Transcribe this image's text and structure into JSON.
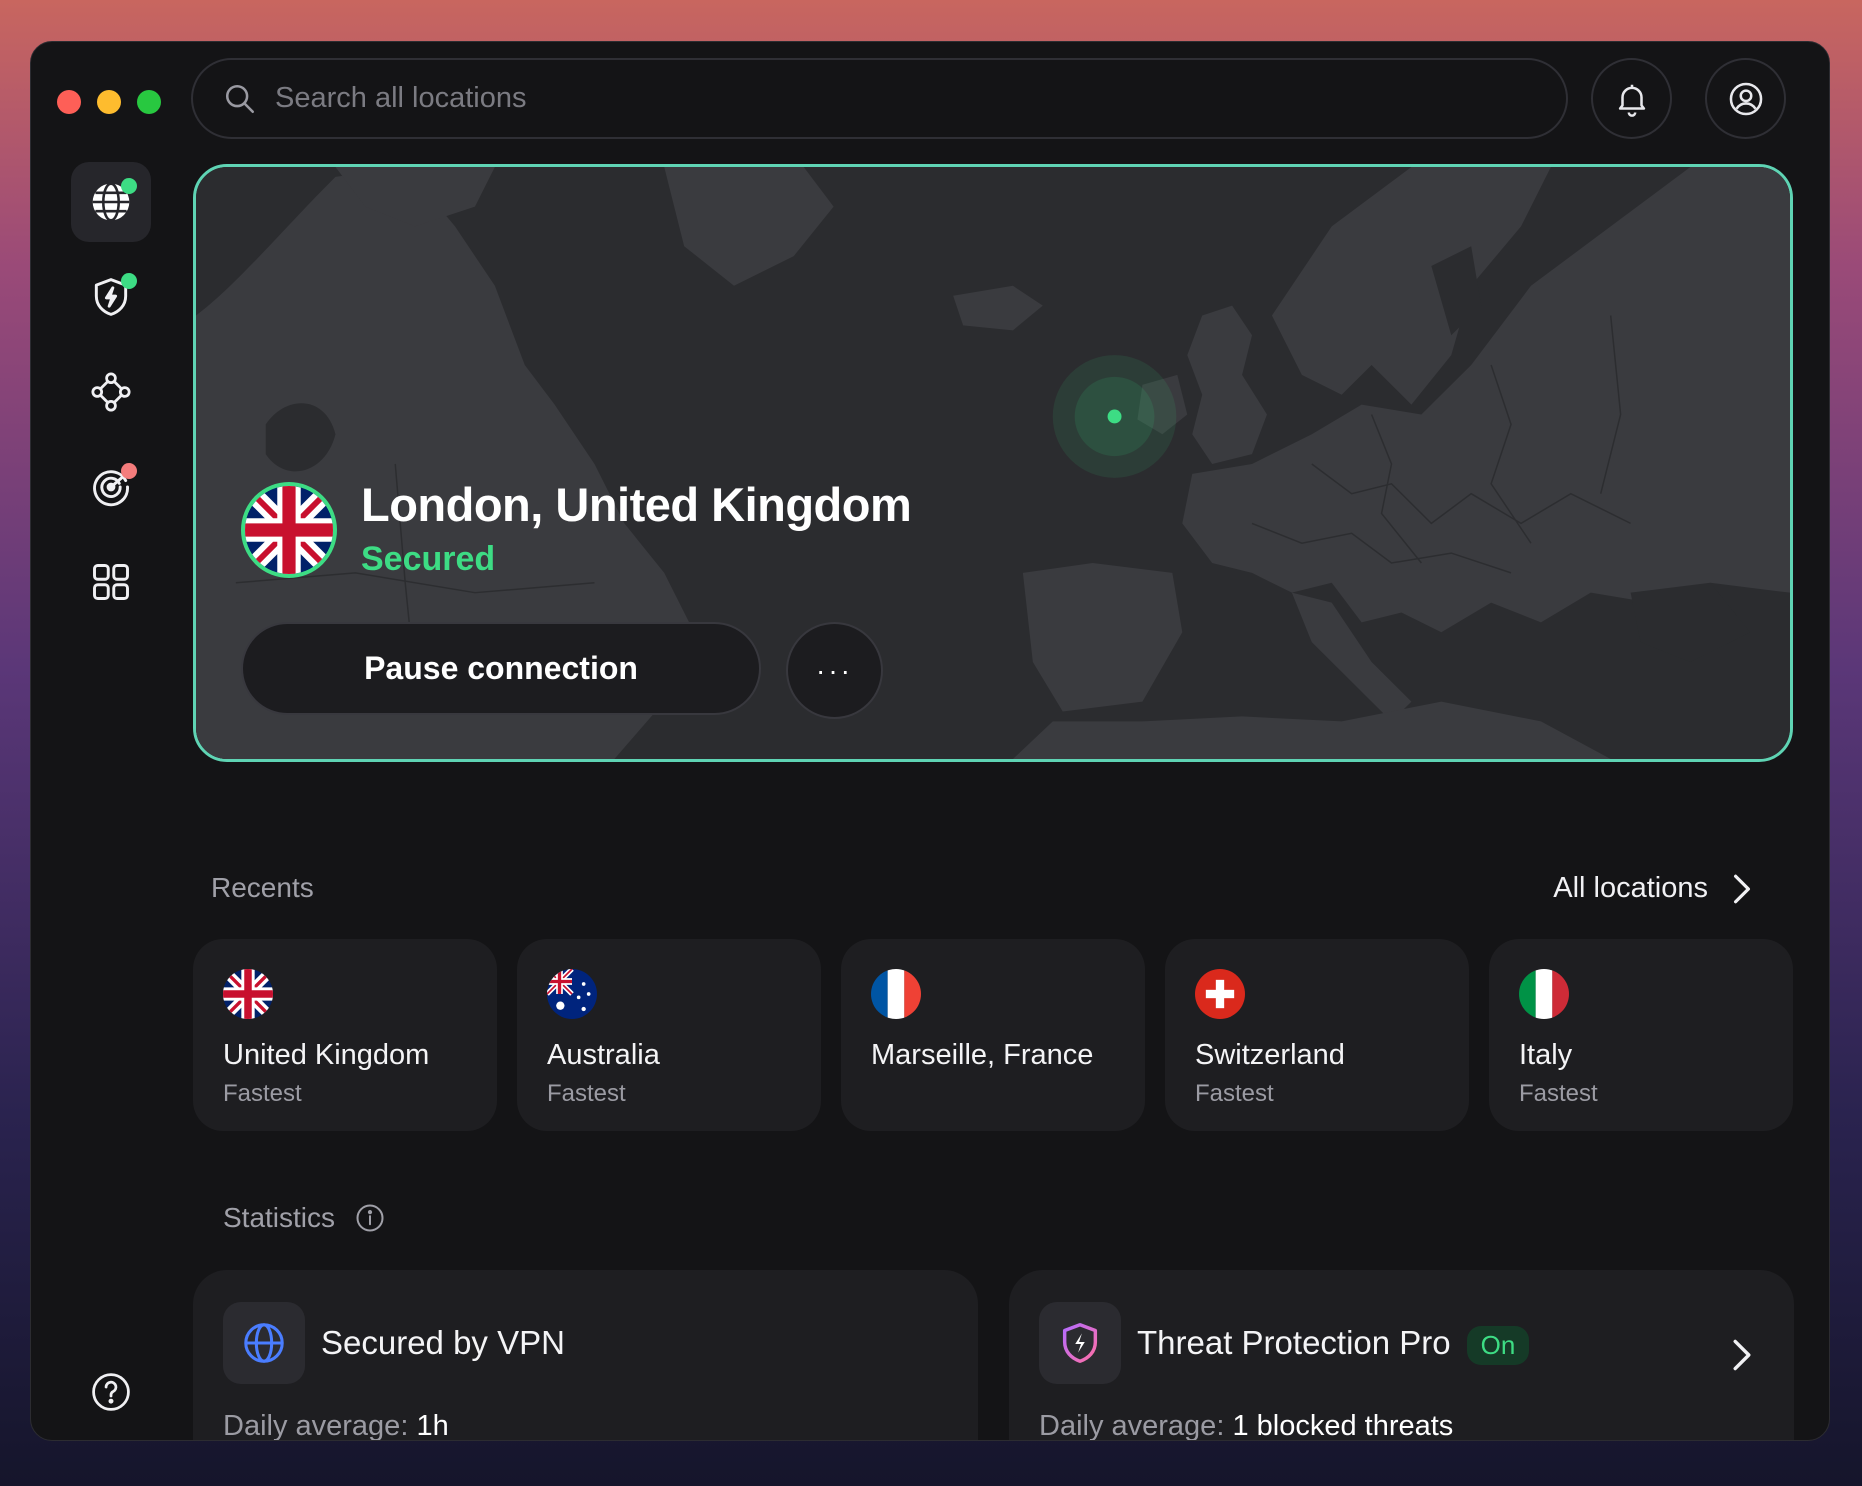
{
  "search": {
    "placeholder": "Search all locations"
  },
  "hero": {
    "location": "London, United Kingdom",
    "status": "Secured",
    "pause_label": "Pause connection",
    "more_label": "···"
  },
  "recents": {
    "label": "Recents",
    "all_locations": "All locations",
    "items": [
      {
        "name": "United Kingdom",
        "sub": "Fastest",
        "flag": "uk"
      },
      {
        "name": "Australia",
        "sub": "Fastest",
        "flag": "au"
      },
      {
        "name": "Marseille, France",
        "sub": "",
        "flag": "fr"
      },
      {
        "name": "Switzerland",
        "sub": "Fastest",
        "flag": "ch"
      },
      {
        "name": "Italy",
        "sub": "Fastest",
        "flag": "it"
      }
    ]
  },
  "statistics": {
    "label": "Statistics",
    "vpn": {
      "title": "Secured by VPN",
      "daily_label": "Daily average:",
      "daily_value": "1h"
    },
    "threat": {
      "title": "Threat Protection Pro",
      "badge": "On",
      "daily_label": "Daily average:",
      "daily_value": "1 blocked threats"
    }
  },
  "colors": {
    "accent": "#3ddc84",
    "hero_border": "#5fd4b4",
    "alert": "#f47c7c"
  }
}
